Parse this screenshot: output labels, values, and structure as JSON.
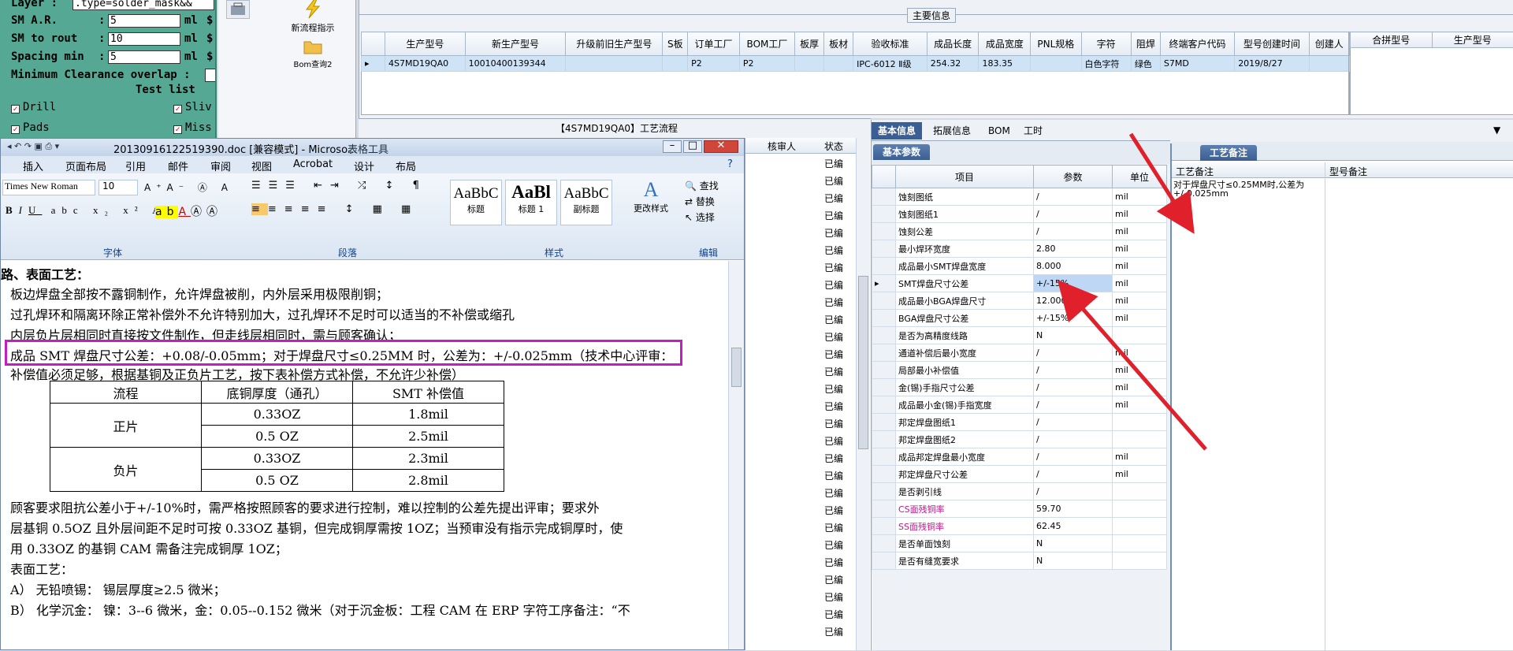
{
  "cad": {
    "layer_label": "Layer :",
    "layer_value": ".type=solder_mask&&",
    "rows": [
      {
        "label": "SM A.R.",
        "value": "5",
        "unit": "ml"
      },
      {
        "label": "SM to rout",
        "value": "10",
        "unit": "ml"
      },
      {
        "label": "Spacing min",
        "value": "5",
        "unit": "ml"
      }
    ],
    "overlap_label": "Minimum Clearance overlap :",
    "test_list": "Test list",
    "checks": [
      "Drill",
      "Sliv",
      "Pads",
      "Miss"
    ]
  },
  "toolstrip": {
    "new_process": "新流程指示",
    "bom_query": "Bom查询2"
  },
  "main": {
    "title": "主要信息",
    "columns": [
      "生产型号",
      "新生产型号",
      "升级前旧生产型号",
      "S板",
      "订单工厂",
      "BOM工厂",
      "板厚",
      "板材",
      "验收标准",
      "成品长度",
      "成品宽度",
      "PNL规格",
      "字符",
      "阻焊",
      "终端客户代码",
      "型号创建时间",
      "创建人"
    ],
    "row": [
      "4S7MD19QA0",
      "10010400139344",
      "",
      "",
      "P2",
      "P2",
      "",
      "",
      "IPC-6012 Ⅱ级",
      "254.32",
      "183.35",
      "",
      "白色字符",
      "绿色",
      "S7MD",
      "2019/8/27",
      ""
    ],
    "right_columns": [
      "合拼型号",
      "生产型号"
    ]
  },
  "process_title": "【4S7MD19QA0】工艺流程",
  "word": {
    "title": "20130916122519390.doc [兼容模式] - Microso...",
    "table_tools": "表格工具",
    "menu": [
      "插入",
      "页面布局",
      "引用",
      "邮件",
      "审阅",
      "视图",
      "Acrobat",
      "设计",
      "布局"
    ],
    "font_name": "Times New Roman",
    "font_size": "10",
    "styles": [
      {
        "preview": "AaBbC",
        "name": "标题"
      },
      {
        "preview": "AaBl",
        "name": "标题 1"
      },
      {
        "preview": "AaBbC",
        "name": "副标题"
      }
    ],
    "change_styles": "更改样式",
    "edit_items": [
      "查找",
      "替换",
      "选择"
    ],
    "groups": [
      "字体",
      "段落",
      "样式",
      "编辑"
    ],
    "lines": [
      "路、表面工艺：",
      "板边焊盘全部按不露铜制作，允许焊盘被削，内外层采用极限削铜；",
      "过孔焊环和隔离环除正常补偿外不允许特别加大，过孔焊环不足时可以适当的不补偿或缩孔",
      "内层负片层相同时直接按文件制作，但走线层相同时，需与顾客确认；",
      "成品 SMT 焊盘尺寸公差：+0.08/-0.05mm；对于焊盘尺寸≤0.25MM 时，公差为：+/-0.025mm（技术中心评审：",
      "补偿值必须足够，根据基铜及正负片工艺，按下表补偿方式补偿，不允许少补偿）"
    ],
    "table_header": [
      "流程",
      "底铜厚度（通孔）",
      "SMT 补偿值"
    ],
    "table_rows": [
      {
        "group": "正片",
        "copper": "0.33OZ",
        "value": "1.8mil"
      },
      {
        "group": "",
        "copper": "0.5 OZ",
        "value": "2.5mil"
      },
      {
        "group": "负片",
        "copper": "0.33OZ",
        "value": "2.3mil"
      },
      {
        "group": "",
        "copper": "0.5 OZ",
        "value": "2.8mil"
      }
    ],
    "lines2": [
      "顾客要求阻抗公差小于+/-10%时，需严格按照顾客的要求进行控制，难以控制的公差先提出评审；要求外",
      "层基铜 0.5OZ 且外层间距不足时可按 0.33OZ 基铜，但完成铜厚需按 1OZ；当预审没有指示完成铜厚时，使",
      "用 0.33OZ 的基铜 CAM 需备注完成铜厚 1OZ；",
      "表面工艺：",
      "A） 无铅喷锡： 锡层厚度≥2.5 微米；",
      "B） 化学沉金： 镍：3--6 微米，金：0.05--0.152 微米（对于沉金板：工程 CAM 在 ERP 字符工序备注：“不"
    ]
  },
  "sidegrid": {
    "headers": [
      "核审人",
      "状态"
    ],
    "status": "已编"
  },
  "detail": {
    "tabs": [
      "基本信息",
      "拓展信息",
      "BOM",
      "工时"
    ],
    "panel_tab": "基本参数",
    "columns": [
      "项目",
      "参数",
      "单位"
    ],
    "rows": [
      {
        "item": "蚀刻图纸",
        "param": "/",
        "unit": "mil"
      },
      {
        "item": "蚀刻图纸1",
        "param": "/",
        "unit": "mil"
      },
      {
        "item": "蚀刻公差",
        "param": "/",
        "unit": "mil"
      },
      {
        "item": "最小焊环宽度",
        "param": "2.80",
        "unit": "mil"
      },
      {
        "item": "成品最小SMT焊盘宽度",
        "param": "8.000",
        "unit": "mil"
      },
      {
        "item": "SMT焊盘尺寸公差",
        "param": "+/-15%",
        "unit": "mil"
      },
      {
        "item": "成品最小BGA焊盘尺寸",
        "param": "12.000",
        "unit": "mil"
      },
      {
        "item": "BGA焊盘尺寸公差",
        "param": "+/-15%",
        "unit": "mil"
      },
      {
        "item": "是否为高精度线路",
        "param": "N",
        "unit": ""
      },
      {
        "item": "通道补偿后最小宽度",
        "param": "/",
        "unit": "mil"
      },
      {
        "item": "局部最小补偿值",
        "param": "/",
        "unit": "mil"
      },
      {
        "item": "金(锡)手指尺寸公差",
        "param": "/",
        "unit": "mil"
      },
      {
        "item": "成品最小金(锡)手指宽度",
        "param": "/",
        "unit": "mil"
      },
      {
        "item": "邦定焊盘图纸1",
        "param": "/",
        "unit": ""
      },
      {
        "item": "邦定焊盘图纸2",
        "param": "/",
        "unit": ""
      },
      {
        "item": "成品邦定焊盘最小宽度",
        "param": "/",
        "unit": "mil"
      },
      {
        "item": "邦定焊盘尺寸公差",
        "param": "/",
        "unit": "mil"
      },
      {
        "item": "是否剥引线",
        "param": "/",
        "unit": ""
      },
      {
        "item": "CS面残铜率",
        "param": "59.70",
        "unit": ""
      },
      {
        "item": "SS面残铜率",
        "param": "62.45",
        "unit": ""
      },
      {
        "item": "是否单面蚀刻",
        "param": "N",
        "unit": ""
      },
      {
        "item": "是否有缝宽要求",
        "param": "N",
        "unit": ""
      }
    ]
  },
  "notes": {
    "tab": "工艺备注",
    "col1": "工艺备注",
    "col2": "型号备注",
    "text1": "对于焊盘尺寸≤0.25MM时,公差为",
    "text2": "+/-0.025mm"
  },
  "colors": {
    "highlight_box": "#c21ec2",
    "arrow": "#e0202a",
    "accent_tab": "#3b5e94"
  }
}
